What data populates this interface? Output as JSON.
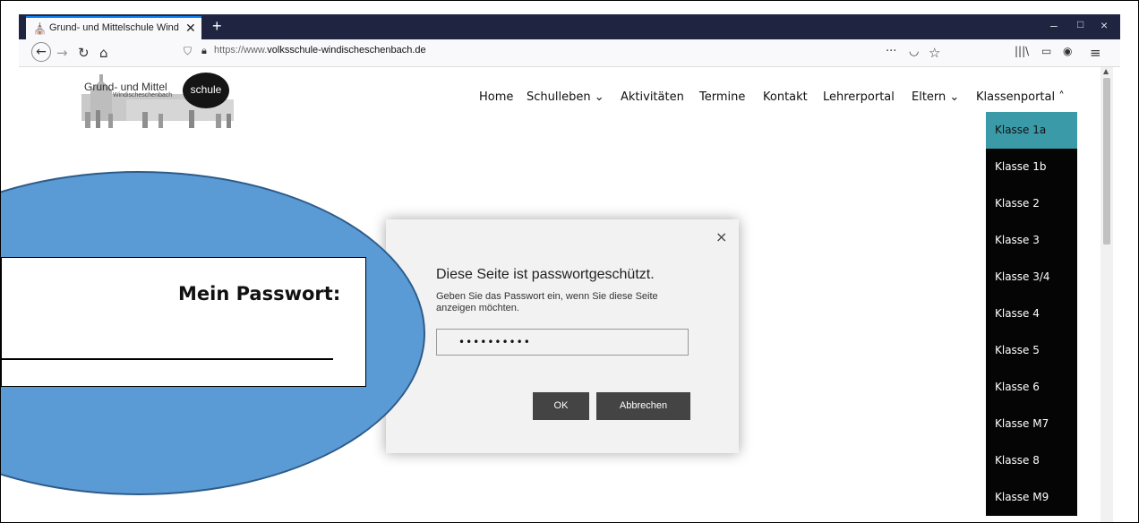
{
  "browser": {
    "tab_title": "Grund- und Mittelschule Windi...",
    "new_tab": "+",
    "window_controls": [
      "–",
      "□",
      "×"
    ],
    "url_prefix": "https://www.",
    "url_domain": "volksschule-windischeschenbach.de",
    "icons": [
      "back-icon",
      "forward-icon",
      "reload-icon",
      "home-icon",
      "shield-icon",
      "lock-icon",
      "more-icon",
      "pocket-icon",
      "bookmark-star-icon",
      "library-icon",
      "sidebar-icon",
      "account-icon",
      "menu-icon"
    ]
  },
  "site": {
    "logo_text": "Grund- und Mittel",
    "logo_circle": "schule",
    "logo_sub": "Windischeschenbach",
    "nav": [
      {
        "label": "Home"
      },
      {
        "label": "Schulleben ⌄"
      },
      {
        "label": "Aktivitäten"
      },
      {
        "label": "Termine"
      },
      {
        "label": "Kontakt"
      },
      {
        "label": "Lehrerportal"
      },
      {
        "label": "Eltern ⌄"
      },
      {
        "label": "Klassenportal ˄"
      }
    ],
    "dropdown": [
      "Klasse 1a",
      "Klasse 1b",
      "Klasse 2",
      "Klasse 3",
      "Klasse 3/4",
      "Klasse 4",
      "Klasse 5",
      "Klasse 6",
      "Klasse M7",
      "Klasse 8",
      "Klasse M9"
    ],
    "dropdown_active": "Klasse 1a"
  },
  "modal": {
    "close": "×",
    "title": "Diese Seite ist passwortgeschützt.",
    "text": "Geben Sie das Passwort ein, wenn Sie diese Seite anzeigen möchten.",
    "password_value": "••••••••••",
    "ok_label": "OK",
    "cancel_label": "Abbrechen"
  },
  "annotation": {
    "label": "Mein Passwort:"
  },
  "colors": {
    "tab_bar": "#1f2441",
    "dropdown_bg": "#050505",
    "dropdown_active": "#3a9aa8",
    "ellipse_fill": "#5b9bd5",
    "button_bg": "#444444"
  }
}
